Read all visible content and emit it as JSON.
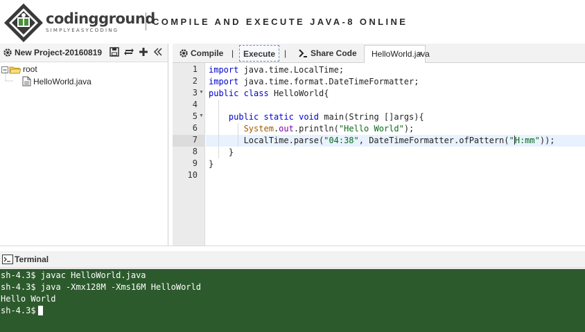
{
  "header": {
    "brand_name": "codingground",
    "brand_tagline": "SIMPLYEASYCODING",
    "title": "COMPILE AND EXECUTE JAVA-8 ONLINE"
  },
  "project": {
    "name": "New Project-20160819",
    "tree": {
      "root_label": "root",
      "file_label": "HelloWorld.java"
    }
  },
  "toolbar": {
    "compile_label": "Compile",
    "separator": "|",
    "execute_label": "Execute",
    "share_label": "Share Code",
    "tab_label": "HelloWorld.java",
    "tab_close": "×"
  },
  "editor": {
    "active_line": 7,
    "line_numbers": [
      "1",
      "2",
      "3",
      "4",
      "5",
      "6",
      "7",
      "8",
      "9",
      "10"
    ],
    "lines": [
      [
        [
          "kw",
          "import"
        ],
        [
          "",
          " java.time.LocalTime;"
        ]
      ],
      [
        [
          "kw",
          "import"
        ],
        [
          "",
          " java.time.format.DateTimeFormatter;"
        ]
      ],
      [
        [
          "kw",
          "public"
        ],
        [
          "",
          " "
        ],
        [
          "kw",
          "class"
        ],
        [
          "",
          " HelloWorld{"
        ]
      ],
      [],
      [
        [
          "",
          "    "
        ],
        [
          "kw",
          "public"
        ],
        [
          "",
          " "
        ],
        [
          "kw",
          "static"
        ],
        [
          "",
          " "
        ],
        [
          "kw",
          "void"
        ],
        [
          "",
          " main(String []args){"
        ]
      ],
      [
        [
          "",
          "       "
        ],
        [
          "cls",
          "System"
        ],
        [
          "",
          "."
        ],
        [
          "kw2",
          "out"
        ],
        [
          "",
          ".println("
        ],
        [
          "str",
          "\"Hello World\""
        ],
        [
          "",
          ");"
        ]
      ],
      [
        [
          "",
          "       LocalTime.parse("
        ],
        [
          "str",
          "\"04:38\""
        ],
        [
          "",
          ", DateTimeFormatter.ofPattern("
        ],
        [
          "str",
          "\""
        ],
        [
          "cursor",
          ""
        ],
        [
          "str",
          "H:mm\""
        ],
        [
          "",
          "));"
        ]
      ],
      [
        [
          "",
          "    }"
        ]
      ],
      [
        [
          "",
          "}"
        ]
      ],
      []
    ]
  },
  "terminal": {
    "title": "Terminal",
    "lines": [
      "sh-4.3$ javac HelloWorld.java",
      "sh-4.3$ java -Xmx128M -Xms16M HelloWorld",
      "Hello World",
      "sh-4.3$"
    ]
  },
  "colors": {
    "terminal_bg": "#2d5a2d",
    "keyword": "#0000cc",
    "string": "#0a6a1c",
    "active_line": "#e8f2fe"
  }
}
